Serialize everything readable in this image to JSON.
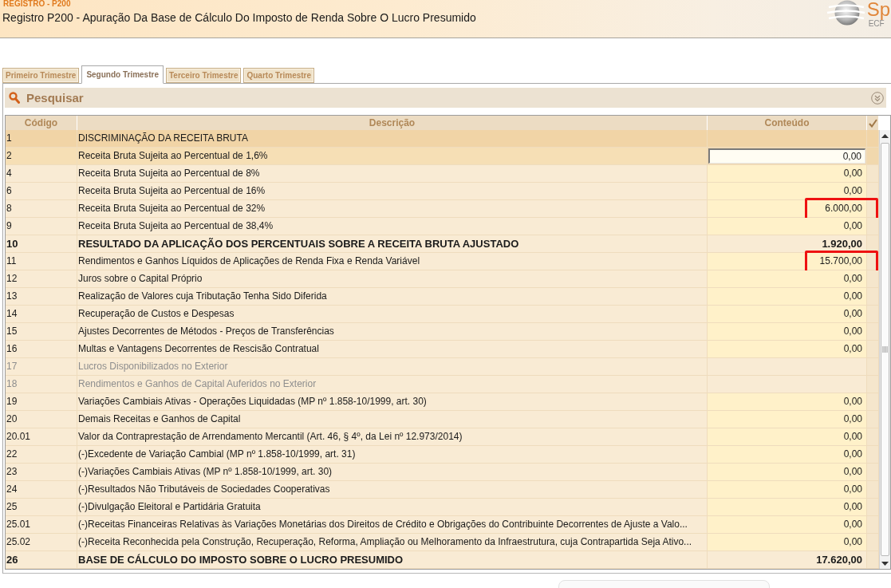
{
  "header": {
    "subtitle": "REGISTRO - P200",
    "title": "Registro P200 - Apuração Da Base de Cálculo Do Imposto de Renda Sobre O Lucro Presumido",
    "logo": {
      "mark": "Sp",
      "caption": "ECF"
    }
  },
  "tabs": [
    {
      "label": "Primeiro Trimestre",
      "selected": false
    },
    {
      "label": "Segundo Trimestre",
      "selected": true
    },
    {
      "label": "Terceiro Trimestre",
      "selected": false
    },
    {
      "label": "Quarto Trimestre",
      "selected": false
    }
  ],
  "search_panel": {
    "title": "Pesquisar",
    "expanded": false
  },
  "table": {
    "columns": [
      "Código",
      "Descrição",
      "Conteúdo"
    ],
    "rows": [
      {
        "code": "1",
        "description": "DISCRIMINAÇÃO DA RECEITA BRUTA",
        "kind": "section",
        "selected": false,
        "disabled": false,
        "highlighted": false
      },
      {
        "code": "2",
        "description": "Receita Bruta Sujeita ao Percentual de 1,6%",
        "kind": "input",
        "value": "0,00",
        "selected": true,
        "disabled": false,
        "highlighted": false
      },
      {
        "code": "4",
        "description": "Receita Bruta Sujeita ao Percentual de 8%",
        "kind": "input",
        "value": "0,00",
        "selected": false,
        "disabled": false,
        "highlighted": false
      },
      {
        "code": "6",
        "description": "Receita Bruta Sujeita ao Percentual de 16%",
        "kind": "input",
        "value": "0,00",
        "selected": false,
        "disabled": false,
        "highlighted": false
      },
      {
        "code": "8",
        "description": "Receita Bruta Sujeita ao Percentual de 32%",
        "kind": "input",
        "value": "6.000,00",
        "selected": false,
        "disabled": false,
        "highlighted": true
      },
      {
        "code": "9",
        "description": "Receita Bruta Sujeita ao Percentual de 38,4%",
        "kind": "input",
        "value": "0,00",
        "selected": false,
        "disabled": false,
        "highlighted": false
      },
      {
        "code": "10",
        "description": "RESULTADO DA APLICAÇÃO DOS PERCENTUAIS SOBRE A RECEITA BRUTA AJUSTADO",
        "kind": "total",
        "value": "1.920,00",
        "selected": false,
        "disabled": false,
        "highlighted": false
      },
      {
        "code": "11",
        "description": "Rendimentos e Ganhos Líquidos de Aplicações de Renda Fixa e Renda Variável",
        "kind": "input",
        "value": "15.700,00",
        "selected": false,
        "disabled": false,
        "highlighted": true
      },
      {
        "code": "12",
        "description": "Juros sobre o Capital Próprio",
        "kind": "input",
        "value": "0,00",
        "selected": false,
        "disabled": false,
        "highlighted": false
      },
      {
        "code": "13",
        "description": "Realização de Valores cuja Tributação Tenha Sido Diferida",
        "kind": "input",
        "value": "0,00",
        "selected": false,
        "disabled": false,
        "highlighted": false
      },
      {
        "code": "14",
        "description": "Recuperação de Custos e Despesas",
        "kind": "input",
        "value": "0,00",
        "selected": false,
        "disabled": false,
        "highlighted": false
      },
      {
        "code": "15",
        "description": "Ajustes Decorrentes de Métodos - Preços de Transferências",
        "kind": "input",
        "value": "0,00",
        "selected": false,
        "disabled": false,
        "highlighted": false
      },
      {
        "code": "16",
        "description": "Multas e Vantagens Decorrentes de Rescisão Contratual",
        "kind": "input",
        "value": "0,00",
        "selected": false,
        "disabled": false,
        "highlighted": false
      },
      {
        "code": "17",
        "description": "Lucros Disponibilizados no Exterior",
        "kind": "input",
        "selected": false,
        "disabled": true,
        "highlighted": false
      },
      {
        "code": "18",
        "description": "Rendimentos e Ganhos de Capital Auferidos no Exterior",
        "kind": "input",
        "selected": false,
        "disabled": true,
        "highlighted": false
      },
      {
        "code": "19",
        "description": "Variações Cambiais Ativas - Operações Liquidadas (MP nº 1.858-10/1999, art. 30)",
        "kind": "input",
        "value": "0,00",
        "selected": false,
        "disabled": false,
        "highlighted": false
      },
      {
        "code": "20",
        "description": "Demais Receitas e Ganhos de Capital",
        "kind": "input",
        "value": "0,00",
        "selected": false,
        "disabled": false,
        "highlighted": false
      },
      {
        "code": "20.01",
        "description": "Valor da Contraprestação de Arrendamento Mercantil (Art. 46, § 4º, da Lei nº 12.973/2014)",
        "kind": "input",
        "value": "0,00",
        "selected": false,
        "disabled": false,
        "highlighted": false
      },
      {
        "code": "22",
        "description": "(-)Excedente de Variação Cambial (MP nº 1.858-10/1999, art. 31)",
        "kind": "input",
        "value": "0,00",
        "selected": false,
        "disabled": false,
        "highlighted": false
      },
      {
        "code": "23",
        "description": "(-)Variações Cambiais Ativas (MP nº 1.858-10/1999, art. 30)",
        "kind": "input",
        "value": "0,00",
        "selected": false,
        "disabled": false,
        "highlighted": false
      },
      {
        "code": "24",
        "description": "(-)Resultados Não Tributáveis de Sociedades Cooperativas",
        "kind": "input",
        "value": "0,00",
        "selected": false,
        "disabled": false,
        "highlighted": false
      },
      {
        "code": "25",
        "description": "(-)Divulgação Eleitoral e Partidária Gratuita",
        "kind": "input",
        "value": "0,00",
        "selected": false,
        "disabled": false,
        "highlighted": false
      },
      {
        "code": "25.01",
        "description": "(-)Receitas Financeiras Relativas às Variações Monetárias dos Direitos de Crédito e Obrigações do Contribuinte Decorrentes de Ajuste a Valo...",
        "kind": "input",
        "value": "0,00",
        "selected": false,
        "disabled": false,
        "highlighted": false
      },
      {
        "code": "25.02",
        "description": "(-)Receita Reconhecida pela Construção, Recuperação, Reforma, Ampliação ou Melhoramento da Infraestrutura, cuja Contrapartida Seja Ativo...",
        "kind": "input",
        "value": "0,00",
        "selected": false,
        "disabled": false,
        "highlighted": false
      },
      {
        "code": "26",
        "description": "BASE DE CÁLCULO DO IMPOSTO SOBRE O LUCRO PRESUMIDO",
        "kind": "total",
        "value": "17.620,00",
        "selected": false,
        "disabled": false,
        "highlighted": false
      }
    ]
  }
}
